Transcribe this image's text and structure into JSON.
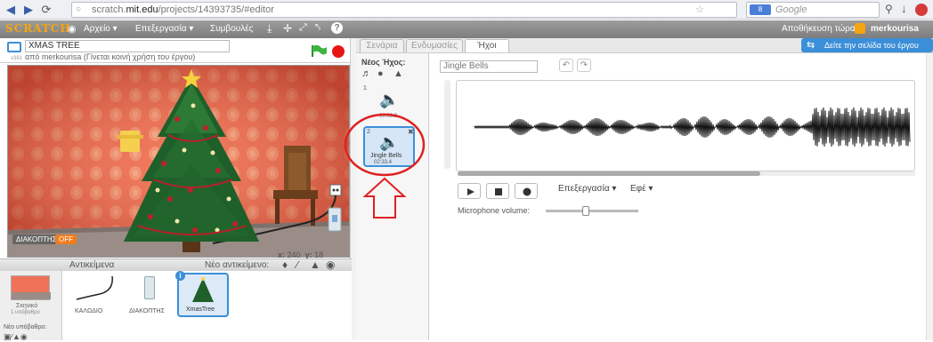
{
  "browser": {
    "url_prefix": "scratch.",
    "url_domain": "mit.edu",
    "url_suffix": "/projects/14393735/#editor",
    "search_placeholder": "Google"
  },
  "menubar": {
    "logo": "SCRATCH",
    "items": [
      "Αρχείο ▾",
      "Επεξεργασία ▾",
      "Συμβουλές"
    ],
    "save_now": "Αποθήκευση τώρα",
    "user": "merkourisa"
  },
  "project": {
    "title": "XMAS TREE",
    "byline": "από merkourisa (Γίνεται κοινή χρήση του έργου)",
    "version": "v381"
  },
  "stage": {
    "switch_label": "ΔΙΑΚΟΠΤΗΣ",
    "switch_value": "OFF",
    "x_label": "x:",
    "x_value": "240",
    "y_label": "y:",
    "y_value": "18"
  },
  "sprites": {
    "header": "Αντικείμενα",
    "new_sprite": "Νέο αντικείμενο:",
    "stage_label": "Σκηνικό",
    "stage_count": "1 υπόβαθρο",
    "new_backdrop": "Νέο υπόβαθρο:",
    "items": [
      "ΚΑΛΩΔΙΟ",
      "ΔΙΑΚΟΠΤΗΣ",
      "XmasTree"
    ]
  },
  "tabs": [
    "Σενάρια",
    "Ενδυμασίες",
    "Ήχοι"
  ],
  "see_project_page": "Δείτε την σελίδα του έργου",
  "sounds": {
    "new_sound": "Νέος Ήχος:",
    "list": [
      {
        "number": "1",
        "name": "",
        "duration": "00:00.8"
      },
      {
        "number": "2",
        "name": "Jingle Bells",
        "duration": "02:33.4"
      }
    ]
  },
  "editor": {
    "sound_name": "Jingle Bells",
    "edit_menu": "Επεξεργασία ▾",
    "effects_menu": "Εφέ ▾",
    "mic_label": "Microphone volume:",
    "mic_volume": 0.45
  },
  "colors": {
    "annotation": "#e02020",
    "selected": "#3b8fd8",
    "switch_off": "#f07c1e"
  }
}
